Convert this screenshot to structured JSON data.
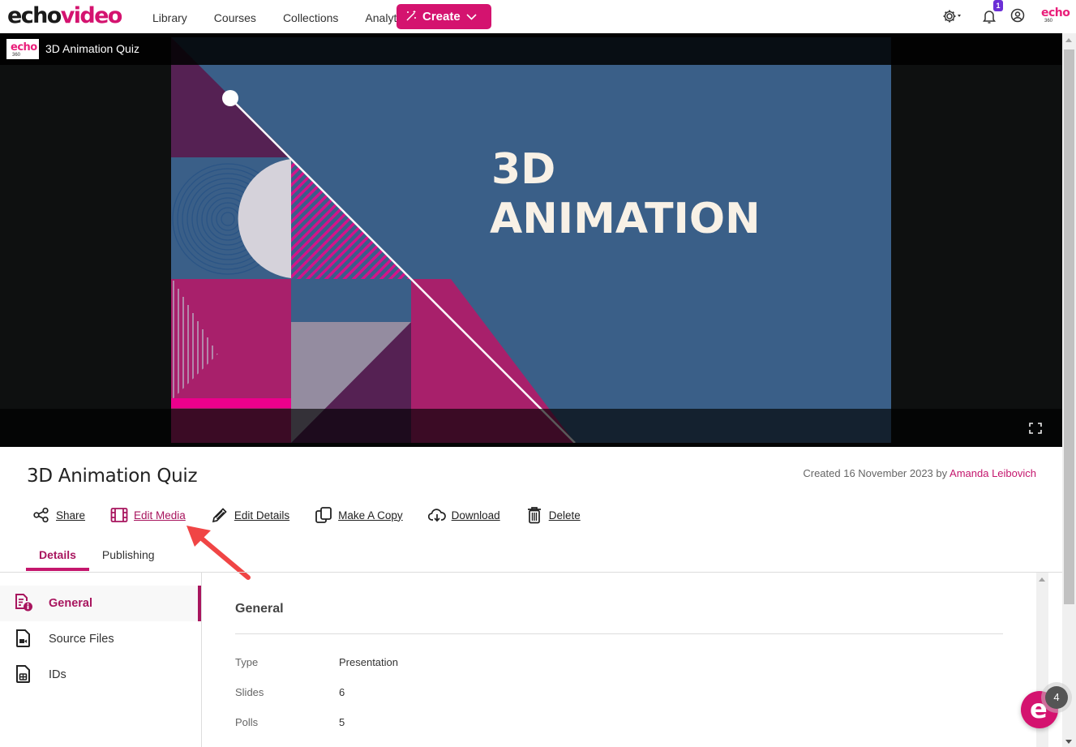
{
  "brand": {
    "echo": "echo",
    "video": "video",
    "accent": "#d4136f"
  },
  "nav": {
    "links": [
      "Library",
      "Courses",
      "Collections",
      "Analytics"
    ],
    "create_label": "Create",
    "notification_count": "1",
    "echo360_logo": {
      "echo": "echo",
      "num": "360"
    }
  },
  "player": {
    "title": "3D Animation Quiz",
    "slide_text_line1": "3D",
    "slide_text_line2": "ANIMATION",
    "logo": {
      "echo": "echo",
      "num": "360"
    }
  },
  "media": {
    "title": "3D Animation Quiz",
    "created_prefix": "Created 16 November 2023 by ",
    "author": "Amanda Leibovich"
  },
  "actions": [
    {
      "label": "Share",
      "icon": "share-icon"
    },
    {
      "label": "Edit Media",
      "icon": "film-icon"
    },
    {
      "label": "Edit Details",
      "icon": "pencil-icon"
    },
    {
      "label": "Make A Copy",
      "icon": "copy-icon"
    },
    {
      "label": "Download",
      "icon": "cloud-download-icon"
    },
    {
      "label": "Delete",
      "icon": "trash-icon"
    }
  ],
  "tabs": [
    {
      "label": "Details",
      "active": true
    },
    {
      "label": "Publishing",
      "active": false
    }
  ],
  "leftmenu": [
    {
      "label": "General",
      "icon": "document-info-icon",
      "active": true
    },
    {
      "label": "Source Files",
      "icon": "file-video-icon",
      "active": false
    },
    {
      "label": "IDs",
      "icon": "file-grid-icon",
      "active": false
    }
  ],
  "general": {
    "heading": "General",
    "fields": [
      {
        "key": "Type",
        "value": "Presentation"
      },
      {
        "key": "Slides",
        "value": "6"
      },
      {
        "key": "Polls",
        "value": "5"
      }
    ]
  },
  "chat": {
    "letter": "e",
    "badge": "4"
  }
}
